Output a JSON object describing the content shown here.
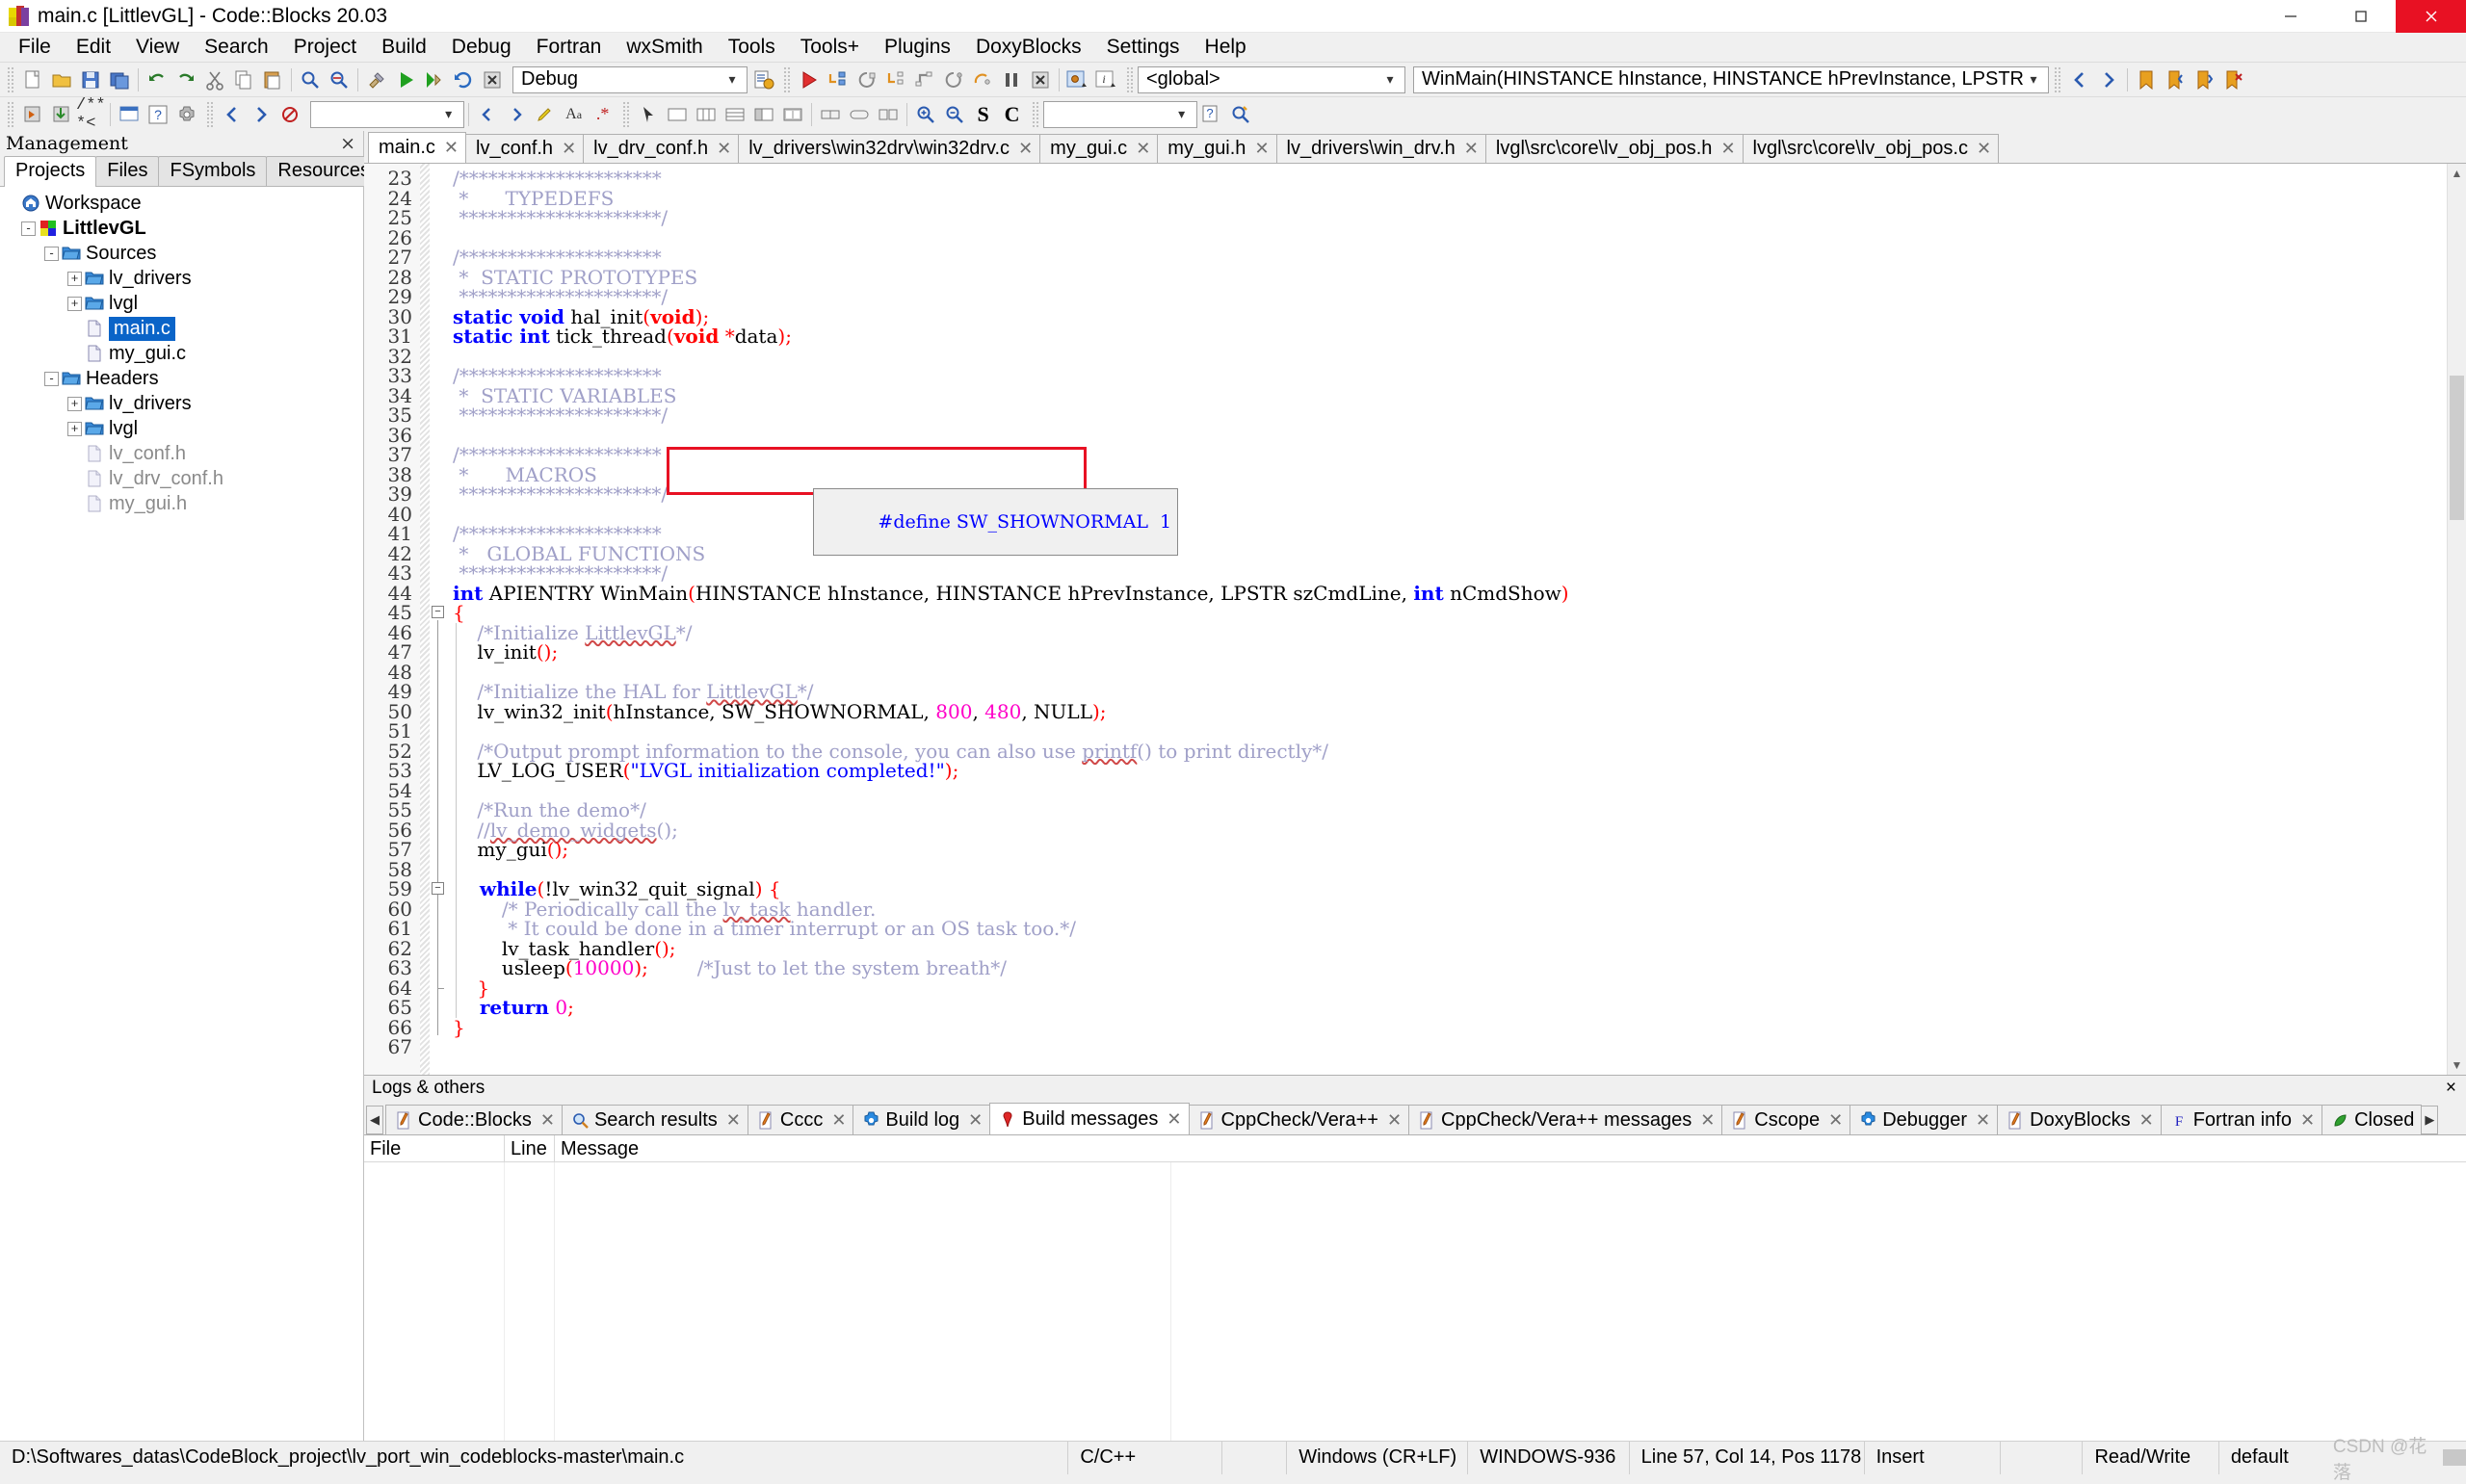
{
  "window": {
    "title": "main.c [LittlevGL] - Code::Blocks 20.03",
    "app_icon": "codeblocks-icon",
    "controls": {
      "minimize": "minimize-icon",
      "maximize": "maximize-icon",
      "close": "close-icon"
    }
  },
  "menu": {
    "items": [
      "File",
      "Edit",
      "View",
      "Search",
      "Project",
      "Build",
      "Debug",
      "Fortran",
      "wxSmith",
      "Tools",
      "Tools+",
      "Plugins",
      "DoxyBlocks",
      "Settings",
      "Help"
    ]
  },
  "toolbar": {
    "build_target": {
      "value": "Debug",
      "placeholder": ""
    },
    "scope": {
      "value": "<global>",
      "placeholder": ""
    },
    "function": {
      "value": "WinMain(HINSTANCE hInstance, HINSTANCE hPrevInstance, LPSTR szCm",
      "placeholder": ""
    },
    "search_box": {
      "value": "",
      "placeholder": ""
    },
    "doxy_box": {
      "value": "",
      "placeholder": ""
    },
    "letters": {
      "s": "S",
      "c": "C"
    }
  },
  "management": {
    "title": "Management",
    "close_label": "×",
    "tabs": [
      {
        "label": "Projects",
        "active": true
      },
      {
        "label": "Files",
        "active": false
      },
      {
        "label": "FSymbols",
        "active": false
      },
      {
        "label": "Resources",
        "active": false
      }
    ],
    "tree": [
      {
        "label": "Workspace",
        "depth": 0,
        "icon": "home-icon",
        "toggle": "",
        "style": "normal"
      },
      {
        "label": "LittlevGL",
        "depth": 1,
        "icon": "project-icon",
        "toggle": "-",
        "style": "bold"
      },
      {
        "label": "Sources",
        "depth": 2,
        "icon": "folder-icon",
        "toggle": "-",
        "style": "normal"
      },
      {
        "label": "lv_drivers",
        "depth": 3,
        "icon": "folder-icon",
        "toggle": "+",
        "style": "normal"
      },
      {
        "label": "lvgl",
        "depth": 3,
        "icon": "folder-icon",
        "toggle": "+",
        "style": "normal"
      },
      {
        "label": "main.c",
        "depth": 3,
        "icon": "file-icon",
        "toggle": "",
        "style": "selected"
      },
      {
        "label": "my_gui.c",
        "depth": 3,
        "icon": "file-icon",
        "toggle": "",
        "style": "normal"
      },
      {
        "label": "Headers",
        "depth": 2,
        "icon": "folder-icon",
        "toggle": "-",
        "style": "normal"
      },
      {
        "label": "lv_drivers",
        "depth": 3,
        "icon": "folder-icon",
        "toggle": "+",
        "style": "normal"
      },
      {
        "label": "lvgl",
        "depth": 3,
        "icon": "folder-icon",
        "toggle": "+",
        "style": "normal"
      },
      {
        "label": "lv_conf.h",
        "depth": 3,
        "icon": "file-icon",
        "toggle": "",
        "style": "dim"
      },
      {
        "label": "lv_drv_conf.h",
        "depth": 3,
        "icon": "file-icon",
        "toggle": "",
        "style": "dim"
      },
      {
        "label": "my_gui.h",
        "depth": 3,
        "icon": "file-icon",
        "toggle": "",
        "style": "dim"
      }
    ]
  },
  "editor": {
    "tabs": [
      {
        "label": "main.c",
        "active": true
      },
      {
        "label": "lv_conf.h",
        "active": false
      },
      {
        "label": "lv_drv_conf.h",
        "active": false
      },
      {
        "label": "lv_drivers\\win32drv\\win32drv.c",
        "active": false
      },
      {
        "label": "my_gui.c",
        "active": false
      },
      {
        "label": "my_gui.h",
        "active": false
      },
      {
        "label": "lv_drivers\\win_drv.h",
        "active": false
      },
      {
        "label": "lvgl\\src\\core\\lv_obj_pos.h",
        "active": false
      },
      {
        "label": "lvgl\\src\\core\\lv_obj_pos.c",
        "active": false
      }
    ],
    "close_glyph": "✕",
    "first_line": 23,
    "lines": [
      {
        "n": 23,
        "tokens": [
          {
            "t": "/*********************",
            "c": "cmt"
          }
        ]
      },
      {
        "n": 24,
        "tokens": [
          {
            "t": " *      TYPEDEFS",
            "c": "cmt"
          }
        ]
      },
      {
        "n": 25,
        "tokens": [
          {
            "t": " *********************/",
            "c": "cmt"
          }
        ]
      },
      {
        "n": 26,
        "tokens": []
      },
      {
        "n": 27,
        "tokens": [
          {
            "t": "/*********************",
            "c": "cmt"
          }
        ]
      },
      {
        "n": 28,
        "tokens": [
          {
            "t": " *  STATIC PROTOTYPES",
            "c": "cmt"
          }
        ]
      },
      {
        "n": 29,
        "tokens": [
          {
            "t": " *********************/",
            "c": "cmt"
          }
        ]
      },
      {
        "n": 30,
        "tokens": [
          {
            "t": "static void",
            "c": "kw"
          },
          {
            "t": " hal_init",
            "c": "pln"
          },
          {
            "t": "(",
            "c": "op"
          },
          {
            "t": "void",
            "c": "typ"
          },
          {
            "t": ")",
            "c": "op"
          },
          {
            "t": ";",
            "c": "op"
          }
        ]
      },
      {
        "n": 31,
        "tokens": [
          {
            "t": "static int",
            "c": "kw"
          },
          {
            "t": " tick_thread",
            "c": "pln"
          },
          {
            "t": "(",
            "c": "op"
          },
          {
            "t": "void",
            "c": "typ"
          },
          {
            "t": " ",
            "c": "pln"
          },
          {
            "t": "*",
            "c": "op"
          },
          {
            "t": "data",
            "c": "pln"
          },
          {
            "t": ")",
            "c": "op"
          },
          {
            "t": ";",
            "c": "op"
          }
        ]
      },
      {
        "n": 32,
        "tokens": []
      },
      {
        "n": 33,
        "tokens": [
          {
            "t": "/*********************",
            "c": "cmt"
          }
        ]
      },
      {
        "n": 34,
        "tokens": [
          {
            "t": " *  STATIC VARIABLES",
            "c": "cmt"
          }
        ]
      },
      {
        "n": 35,
        "tokens": [
          {
            "t": " *********************/",
            "c": "cmt"
          }
        ]
      },
      {
        "n": 36,
        "tokens": []
      },
      {
        "n": 37,
        "tokens": [
          {
            "t": "/*********************",
            "c": "cmt"
          }
        ]
      },
      {
        "n": 38,
        "tokens": [
          {
            "t": " *      MACROS",
            "c": "cmt"
          }
        ]
      },
      {
        "n": 39,
        "tokens": [
          {
            "t": " *********************/",
            "c": "cmt"
          }
        ]
      },
      {
        "n": 40,
        "tokens": []
      },
      {
        "n": 41,
        "tokens": [
          {
            "t": "/*********************",
            "c": "cmt"
          }
        ]
      },
      {
        "n": 42,
        "tokens": [
          {
            "t": " *   GLOBAL FUNCTIONS",
            "c": "cmt"
          }
        ]
      },
      {
        "n": 43,
        "tokens": [
          {
            "t": " *********************/",
            "c": "cmt"
          }
        ]
      },
      {
        "n": 44,
        "tokens": [
          {
            "t": "int",
            "c": "kw"
          },
          {
            "t": " APIENTRY WinMain",
            "c": "pln"
          },
          {
            "t": "(",
            "c": "op"
          },
          {
            "t": "HINSTANCE hInstance, HINSTANCE hPrevInstance, LPSTR szCmdLine, ",
            "c": "pln"
          },
          {
            "t": "int",
            "c": "kw"
          },
          {
            "t": " nCmdShow",
            "c": "pln"
          },
          {
            "t": ")",
            "c": "op"
          }
        ]
      },
      {
        "n": 45,
        "tokens": [
          {
            "t": "{",
            "c": "op"
          }
        ]
      },
      {
        "n": 46,
        "tokens": [
          {
            "t": "    /*Initialize ",
            "c": "cmt"
          },
          {
            "t": "LittlevGL",
            "c": "cmt-squig"
          },
          {
            "t": "*/",
            "c": "cmt"
          }
        ]
      },
      {
        "n": 47,
        "tokens": [
          {
            "t": "    lv_init",
            "c": "pln"
          },
          {
            "t": "()",
            "c": "op"
          },
          {
            "t": ";",
            "c": "op"
          }
        ]
      },
      {
        "n": 48,
        "tokens": []
      },
      {
        "n": 49,
        "tokens": [
          {
            "t": "    /*Initialize the HAL for ",
            "c": "cmt"
          },
          {
            "t": "LittlevGL",
            "c": "cmt-squig"
          },
          {
            "t": "*/",
            "c": "cmt"
          }
        ]
      },
      {
        "n": 50,
        "tokens": [
          {
            "t": "    lv_win32_init",
            "c": "pln"
          },
          {
            "t": "(",
            "c": "op"
          },
          {
            "t": "hInstance, SW_SHOWNORMAL, ",
            "c": "pln"
          },
          {
            "t": "800",
            "c": "num"
          },
          {
            "t": ", ",
            "c": "pln"
          },
          {
            "t": "480",
            "c": "num"
          },
          {
            "t": ", NULL",
            "c": "pln"
          },
          {
            "t": ")",
            "c": "op"
          },
          {
            "t": ";",
            "c": "op"
          }
        ]
      },
      {
        "n": 51,
        "tokens": []
      },
      {
        "n": 52,
        "tokens": [
          {
            "t": "    /*Output prompt information to the console, you can also use ",
            "c": "cmt"
          },
          {
            "t": "printf",
            "c": "cmt-squig"
          },
          {
            "t": "() to print directly*/",
            "c": "cmt"
          }
        ]
      },
      {
        "n": 53,
        "tokens": [
          {
            "t": "    LV_LOG_USER",
            "c": "pln"
          },
          {
            "t": "(",
            "c": "op"
          },
          {
            "t": "\"LVGL initialization completed!\"",
            "c": "str"
          },
          {
            "t": ")",
            "c": "op"
          },
          {
            "t": ";",
            "c": "op"
          }
        ]
      },
      {
        "n": 54,
        "tokens": []
      },
      {
        "n": 55,
        "tokens": [
          {
            "t": "    /*Run the demo*/",
            "c": "cmt"
          }
        ]
      },
      {
        "n": 56,
        "tokens": [
          {
            "t": "    //",
            "c": "cmt"
          },
          {
            "t": "lv_demo_widgets",
            "c": "cmt-squig"
          },
          {
            "t": "();",
            "c": "cmt"
          }
        ]
      },
      {
        "n": 57,
        "tokens": [
          {
            "t": "    my_gui",
            "c": "pln"
          },
          {
            "t": "()",
            "c": "op"
          },
          {
            "t": ";",
            "c": "op"
          }
        ]
      },
      {
        "n": 58,
        "tokens": []
      },
      {
        "n": 59,
        "tokens": [
          {
            "t": "    while",
            "c": "kw"
          },
          {
            "t": "(",
            "c": "op"
          },
          {
            "t": "!lv_win32_quit_signal",
            "c": "pln"
          },
          {
            "t": ")",
            "c": "op"
          },
          {
            "t": " ",
            "c": "pln"
          },
          {
            "t": "{",
            "c": "op"
          }
        ]
      },
      {
        "n": 60,
        "tokens": [
          {
            "t": "        /* Periodically call the ",
            "c": "cmt"
          },
          {
            "t": "lv_task",
            "c": "cmt-squig"
          },
          {
            "t": " handler.",
            "c": "cmt"
          }
        ]
      },
      {
        "n": 61,
        "tokens": [
          {
            "t": "         * It could be done in a timer interrupt or an OS task too.*/",
            "c": "cmt"
          }
        ]
      },
      {
        "n": 62,
        "tokens": [
          {
            "t": "        lv_task_handler",
            "c": "pln"
          },
          {
            "t": "()",
            "c": "op"
          },
          {
            "t": ";",
            "c": "op"
          }
        ]
      },
      {
        "n": 63,
        "tokens": [
          {
            "t": "        usleep",
            "c": "pln"
          },
          {
            "t": "(",
            "c": "op"
          },
          {
            "t": "10000",
            "c": "num"
          },
          {
            "t": ")",
            "c": "op"
          },
          {
            "t": ";",
            "c": "op"
          },
          {
            "t": "        /*Just to let the system breath*/",
            "c": "cmt"
          }
        ]
      },
      {
        "n": 64,
        "tokens": [
          {
            "t": "    }",
            "c": "op"
          }
        ]
      },
      {
        "n": 65,
        "tokens": [
          {
            "t": "    return",
            "c": "kw"
          },
          {
            "t": " ",
            "c": "pln"
          },
          {
            "t": "0",
            "c": "num"
          },
          {
            "t": ";",
            "c": "op"
          }
        ]
      },
      {
        "n": 66,
        "tokens": [
          {
            "t": "}",
            "c": "op"
          }
        ]
      },
      {
        "n": 67,
        "tokens": []
      }
    ],
    "annotation": {
      "type": "red-rectangle",
      "color": "#e81123"
    },
    "tooltip": {
      "text": "#define SW_SHOWNORMAL  1",
      "keyword": "SW_SHOWNORMAL"
    }
  },
  "logs": {
    "title": "Logs & others",
    "close_label": "×",
    "nav_left": "◀",
    "nav_right": "▶",
    "tabs": [
      {
        "label": "Code::Blocks",
        "icon": "pencil-icon",
        "active": false
      },
      {
        "label": "Search results",
        "icon": "magnifier-icon",
        "active": false
      },
      {
        "label": "Cccc",
        "icon": "pencil-icon",
        "active": false
      },
      {
        "label": "Build log",
        "icon": "gear-icon",
        "active": false
      },
      {
        "label": "Build messages",
        "icon": "pin-icon",
        "active": true
      },
      {
        "label": "CppCheck/Vera++",
        "icon": "pencil-icon",
        "active": false
      },
      {
        "label": "CppCheck/Vera++ messages",
        "icon": "pencil-icon",
        "active": false
      },
      {
        "label": "Cscope",
        "icon": "pencil-icon",
        "active": false
      },
      {
        "label": "Debugger",
        "icon": "gear-icon",
        "active": false
      },
      {
        "label": "DoxyBlocks",
        "icon": "pencil-icon",
        "active": false
      },
      {
        "label": "Fortran info",
        "icon": "f-icon",
        "active": false
      },
      {
        "label": "Closed",
        "icon": "leaf-icon",
        "active": false
      }
    ],
    "columns": [
      "File",
      "Line",
      "Message"
    ],
    "rows": []
  },
  "statusbar": {
    "path": "D:\\Softwares_datas\\CodeBlock_project\\lv_port_win_codeblocks-master\\main.c",
    "language": "C/C++",
    "eol": "Windows (CR+LF)",
    "encoding": "WINDOWS-936",
    "caret": "Line 57, Col 14, Pos 1178",
    "insert_mode": "Insert",
    "blank": "",
    "readonly": "Read/Write",
    "profile": "default",
    "watermark": "CSDN @花落"
  }
}
